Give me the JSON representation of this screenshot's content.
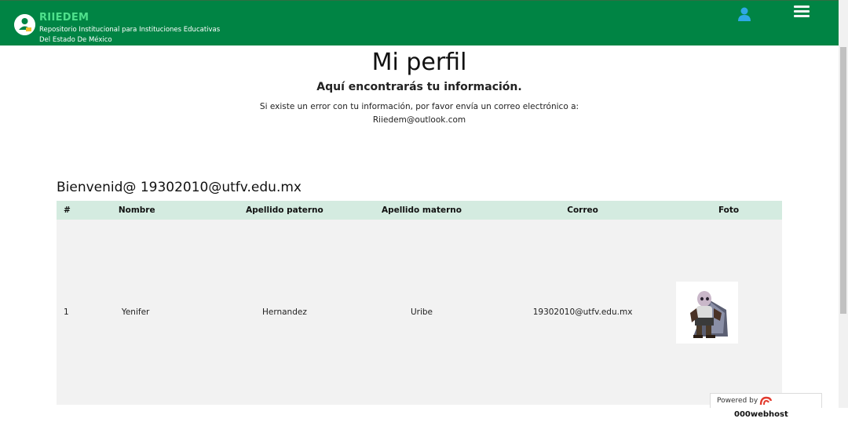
{
  "navbar": {
    "brand_title": "RIIEDEM",
    "brand_subtitle": "Repositorio Institucional para Instituciones Educativas Del Estado De México",
    "user_icon": "user-icon",
    "menu_icon": "hamburger-icon",
    "color": "#008444"
  },
  "header": {
    "title": "Mi perfil",
    "subtitle": "Aquí encontrarás tu información.",
    "note_line1": "Si existe un error con tu información, por favor envía un correo electrónico a:",
    "note_email": "Riiedem@outlook.com"
  },
  "welcome": "Bienvenid@ 19302010@utfv.edu.mx",
  "table": {
    "headers": [
      "#",
      "Nombre",
      "Apellido paterno",
      "Apellido materno",
      "Correo",
      "Foto"
    ],
    "rows": [
      [
        "1",
        "Yenifer",
        "Hernandez",
        "Uribe",
        "19302010@utfv.edu.mx",
        "photo"
      ]
    ]
  },
  "footer_badge": {
    "label": "Powered by",
    "brand": "000webhost"
  }
}
